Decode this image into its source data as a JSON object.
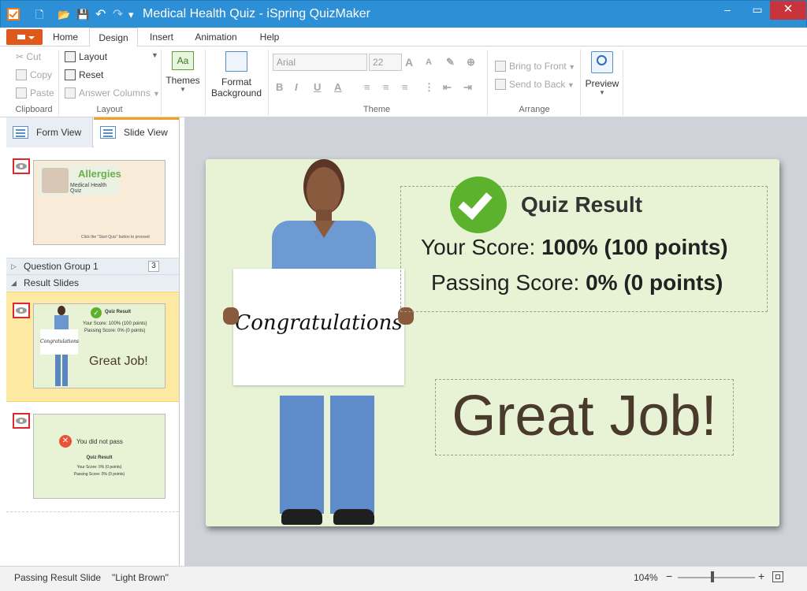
{
  "window": {
    "title": "Medical Health Quiz - iSpring QuizMaker",
    "minimize": "–",
    "maximize": "▭",
    "close": "✕"
  },
  "quick_access": {
    "new": "🗋",
    "open": "📂",
    "save": "💾",
    "undo": "↶",
    "redo": "↷",
    "more": "▾"
  },
  "tabs": [
    "Home",
    "Design",
    "Insert",
    "Animation",
    "Help"
  ],
  "active_tab": "Design",
  "ribbon": {
    "clipboard": {
      "cut": "Cut",
      "copy": "Copy",
      "paste": "Paste",
      "label": "Clipboard"
    },
    "layout": {
      "layout": "Layout",
      "reset": "Reset",
      "answer_columns": "Answer Columns",
      "label": "Layout"
    },
    "themes": {
      "button": "Themes",
      "icon_text": "Aa"
    },
    "format_background": {
      "line1": "Format",
      "line2": "Background"
    },
    "theme": {
      "font": "Arial",
      "size": "22",
      "label": "Theme"
    },
    "arrange": {
      "bring_front": "Bring to Front",
      "send_back": "Send to Back",
      "label": "Arrange"
    },
    "preview": "Preview"
  },
  "left_panel": {
    "form_view": "Form View",
    "slide_view": "Slide View",
    "intro_slide": {
      "title": "Allergies",
      "subtitle": "Medical Health Quiz",
      "hint": "Click the \"Start Quiz\" button to proceed"
    },
    "question_group": {
      "label": "Question Group 1",
      "count": "3"
    },
    "result_slides_label": "Result Slides",
    "pass_thumb": {
      "title": "Quiz Result",
      "score": "Your Score: 100% (100 points)",
      "passing": "Passing Score: 0% (0 points)",
      "great": "Great Job!",
      "sign": "Congratulations"
    },
    "fail_thumb": {
      "title": "You did not pass",
      "heading": "Quiz Result",
      "score": "Your Score: 0% (0 points)",
      "passing": "Passing Score: 0% (0 points)"
    }
  },
  "slide": {
    "quiz_result": "Quiz Result",
    "score_label": "Your Score: ",
    "score_value": "100% (100 points)",
    "passing_label": "Passing Score: ",
    "passing_value": "0% (0 points)",
    "sign_text": "Congratulations",
    "great_job": "Great Job!"
  },
  "status": {
    "slide_name": "Passing Result Slide",
    "theme": "\"Light Brown\"",
    "zoom": "104%",
    "zoom_minus": "−",
    "zoom_plus": "+",
    "zoom_level": 0.45
  },
  "colors": {
    "accent": "#2d8fd5",
    "slide_bg": "#e8f3d6",
    "check_green": "#5cb22c",
    "fail_red": "#e8523a"
  }
}
